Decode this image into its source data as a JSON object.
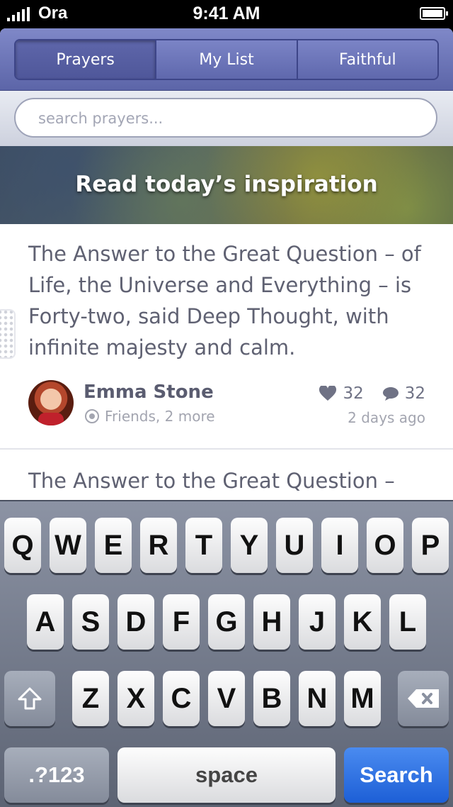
{
  "status_bar": {
    "carrier": "Ora",
    "time": "9:41 AM"
  },
  "tabs": [
    {
      "label": "Prayers",
      "selected": true
    },
    {
      "label": "My List",
      "selected": false
    },
    {
      "label": "Faithful",
      "selected": false
    }
  ],
  "search": {
    "placeholder": "search prayers...",
    "value": ""
  },
  "banner": {
    "text": "Read today’s inspiration"
  },
  "posts": [
    {
      "text": "The Answer to the Great Question – of Life, the Universe and Everything – is Forty-two, said Deep Thought, with infinite majesty and calm.",
      "author": "Emma Stone",
      "audience": "Friends, 2 more",
      "likes": "32",
      "comments": "32",
      "date": "2 days ago"
    },
    {
      "text": "The Answer to the Great Question –"
    }
  ],
  "keyboard": {
    "row1": [
      "Q",
      "W",
      "E",
      "R",
      "T",
      "Y",
      "U",
      "I",
      "O",
      "P"
    ],
    "row2": [
      "A",
      "S",
      "D",
      "F",
      "G",
      "H",
      "J",
      "K",
      "L"
    ],
    "row3": [
      "Z",
      "X",
      "C",
      "V",
      "B",
      "N",
      "M"
    ],
    "numbers_label": ".?123",
    "space_label": "space",
    "search_label": "Search"
  },
  "colors": {
    "nav": "#6a73b6",
    "search_key": "#2a6ee0"
  }
}
